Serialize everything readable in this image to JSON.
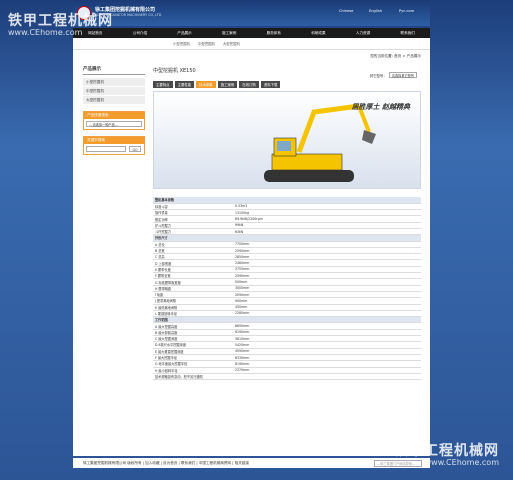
{
  "watermark": {
    "top_title": "铁甲工程机械网",
    "top_url": "www.CEhome.com",
    "bottom_title": "铁甲工程机械网",
    "bottom_url": "www.CEhome.com"
  },
  "header": {
    "brand": "徐工集团挖掘机械有限公司",
    "brand_sub": "XCMG EXCAVATOR MACHINERY CO.,LTD",
    "lang_cn": "Chinese",
    "lang_en": "English",
    "lang_ru": "Рус.com"
  },
  "nav": [
    "网站首页",
    "公司介绍",
    "产品展示",
    "施工案例",
    "服务体系",
    "科研成果",
    "人力资源",
    "联系我们"
  ],
  "subnav": [
    "小型挖掘机",
    "中型挖掘机",
    "大型挖掘机"
  ],
  "left": {
    "heading": "产品展示",
    "cats": [
      "小型挖掘机",
      "中型挖掘机",
      "大型挖掘机"
    ],
    "search_title": "产品快速搜索",
    "search_select": "---请选择一种产品---",
    "kw_title": "关键字搜索",
    "go": "GO"
  },
  "right": {
    "breadcrumb": "您的当前位置: 首页 > 产品展示",
    "title": "中型挖掘机  XE150",
    "other_label": "其它型号：",
    "other_select": "请选择其它型号",
    "tabs": [
      "主要特点",
      "主要性能",
      "技术参数",
      "施工案例",
      "在线订购",
      "资料下载"
    ],
    "slogan": "居胜厚土  赵越精典"
  },
  "spec": [
    {
      "sec": "整机基本参数"
    },
    {
      "k": "标准斗容",
      "v": "0.53m3"
    },
    {
      "k": "操作重量",
      "v": "13100kg"
    },
    {
      "k": "额定功率",
      "v": "69.9kW/2200rpm"
    },
    {
      "k": "铲斗挖掘力",
      "v": "99kN"
    },
    {
      "k": "斗杆挖掘力",
      "v": "63kN"
    },
    {
      "sec": "外形尺寸"
    },
    {
      "k": "A 总长",
      "v": "7700mm"
    },
    {
      "k": "B 总宽",
      "v": "2590mm"
    },
    {
      "k": "C 总高",
      "v": "2850mm"
    },
    {
      "k": "D 上部宽度",
      "v": "2460mm"
    },
    {
      "k": "E 履带长度",
      "v": "3755mm"
    },
    {
      "k": "F 履带全宽",
      "v": "2590mm"
    },
    {
      "k": "G 标准履带板宽度",
      "v": "500mm"
    },
    {
      "k": "H 履带轴距",
      "v": "3000mm"
    },
    {
      "k": "I 轨距",
      "v": "2090mm"
    },
    {
      "k": "J 配重离地间隙",
      "v": "900mm"
    },
    {
      "k": "K 最低离地间隙",
      "v": "450mm"
    },
    {
      "k": "L 尾部回转半径",
      "v": "2280mm"
    },
    {
      "sec": "工作范围"
    },
    {
      "k": "A 最大挖掘高度",
      "v": "8650mm"
    },
    {
      "k": "B 最大卸载高度",
      "v": "6190mm"
    },
    {
      "k": "C 最大挖掘深度",
      "v": "5610mm"
    },
    {
      "k": "D 8英尺水平挖掘深度",
      "v": "5420mm"
    },
    {
      "k": "E 最大垂直挖掘深度",
      "v": "4590mm"
    },
    {
      "k": "F 最大挖掘半径",
      "v": "8330mm"
    },
    {
      "k": "G 地平面最大挖掘半径",
      "v": "8190mm"
    },
    {
      "k": "H 最小回转半径",
      "v": "2370mm"
    },
    {
      "note": "技术规格如有变动，恕不另行通知"
    }
  ],
  "footer": {
    "company": "徐工集团挖掘机械有限公司  版权所有",
    "links": "| 加入收藏 | 设为首页 | 联系我们 | 中国工程机械商贸网 | 相关链接",
    "search": "—徐工集团门户网站导航—"
  }
}
